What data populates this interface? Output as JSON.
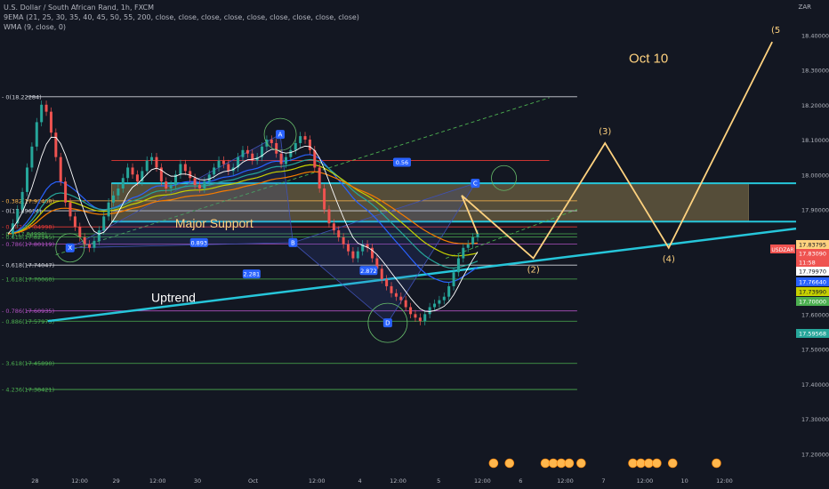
{
  "header": {
    "title": "U.S. Dollar / South African Rand, 1h, FXCM",
    "ema_line": "9EMA (21, 25, 30, 35, 40, 45, 50, 55, 200, close, close, close, close, close, close, close, close, close)",
    "wma_line": "WMA (9, close, 0)"
  },
  "currency": "ZAR",
  "colors": {
    "background": "#131722",
    "up": "#26a69a",
    "down": "#ef5350",
    "uptrend": "#26c6da",
    "projection": "#ffd27f",
    "fib_green": "#4caf50",
    "fib_purple": "#b050c0",
    "fib_red": "#e53935",
    "zone": "#8d7a4d",
    "harmonic": "#3f51b5",
    "ema_orange": "#f57c00",
    "ema_yellow": "#c6d000",
    "ema_blue": "#2962ff"
  },
  "annotations": {
    "date_label": "Oct 10",
    "support_label": "Major Support",
    "uptrend_label": "Uptrend"
  },
  "chart_data": {
    "type": "candlestick",
    "symbol": "USDZAR",
    "price_axis_ticks": [
      18.4,
      18.3,
      18.2,
      18.1,
      18.0,
      17.9,
      17.8,
      17.7,
      17.6,
      17.5,
      17.4,
      17.3,
      17.2
    ],
    "price_tick_labels": [
      "18.40000",
      "18.30000",
      "18.20000",
      "18.10000",
      "18.00000",
      "17.90000",
      "17.80000",
      "17.70000",
      "17.60000",
      "17.50000",
      "17.40000",
      "17.30000",
      "17.20000"
    ],
    "time_tick_labels": [
      "28",
      "12:00",
      "29",
      "12:00",
      "30",
      "Oct",
      "12:00",
      "4",
      "12:00",
      "5",
      "12:00",
      "6",
      "12:00",
      "7",
      "12:00",
      "10",
      "12:00"
    ],
    "price_badges": [
      {
        "text": "USDZAR",
        "color": "#ef5350"
      },
      {
        "text": "17.83795",
        "color": "#ffd27f"
      },
      {
        "text": "17.83090",
        "color": "#ef5350"
      },
      {
        "text": "11:58",
        "color": "#ef5350"
      },
      {
        "text": "17.79970",
        "color": "#ffffff"
      },
      {
        "text": "17.76640",
        "color": "#2962ff"
      },
      {
        "text": "17.73990",
        "color": "#c6d000"
      },
      {
        "text": "17.70000",
        "color": "#4caf50"
      },
      {
        "text": "17.59568",
        "color": "#26a69a"
      }
    ],
    "fib_levels": [
      {
        "label": "0(18.22284)",
        "value": 18.22284,
        "color": "#d1d4dc"
      },
      {
        "label": "0(17.89614)",
        "value": 17.89614,
        "color": "#d1d4dc"
      },
      {
        "label": "0.382(17.92468)",
        "value": 17.92468,
        "color": "#ffb74d"
      },
      {
        "label": "0.382(17.84998)",
        "value": 17.84998,
        "color": "#e53935"
      },
      {
        "label": "0.5(17.84998)",
        "value": 17.83,
        "color": "#4caf50"
      },
      {
        "label": "0.618(17.82145)",
        "value": 17.82145,
        "color": "#4caf50"
      },
      {
        "label": "0.786(17.80119)",
        "value": 17.80119,
        "color": "#b050c0"
      },
      {
        "label": "0.618(17.74047)",
        "value": 17.74047,
        "color": "#d1d4dc"
      },
      {
        "label": "1.618(17.70060)",
        "value": 17.7006,
        "color": "#4caf50"
      },
      {
        "label": "0.786(17.60935)",
        "value": 17.60935,
        "color": "#b050c0"
      },
      {
        "label": "0.886(17.57975)",
        "value": 17.57975,
        "color": "#4caf50"
      },
      {
        "label": "3.618(17.45890)",
        "value": 17.4589,
        "color": "#4caf50"
      },
      {
        "label": "4.236(17.38421)",
        "value": 17.38421,
        "color": "#4caf50"
      }
    ],
    "harmonic_points": [
      {
        "label": "X",
        "price": 17.79,
        "time": 0.088
      },
      {
        "label": "A",
        "price": 18.115,
        "time": 0.352
      },
      {
        "label": "B",
        "price": 17.805,
        "time": 0.368
      },
      {
        "label": "C",
        "price": 17.975,
        "time": 0.597
      },
      {
        "label": "D",
        "price": 17.575,
        "time": 0.487
      }
    ],
    "harmonic_ratios": [
      "0.56",
      "0.893",
      "2.281",
      "2.872"
    ],
    "projection_wave": [
      {
        "label": "",
        "time": 0.58,
        "price": 17.94
      },
      {
        "label": "(2)",
        "time": 0.67,
        "price": 17.76
      },
      {
        "label": "(3)",
        "time": 0.76,
        "price": 18.09
      },
      {
        "label": "(4)",
        "time": 0.84,
        "price": 17.79
      },
      {
        "label": "(5",
        "time": 0.97,
        "price": 18.38
      }
    ],
    "candles_ohlc_hint": "hourly candles from 28 Sep to 5 Oct, range approx 17.56 - 18.23",
    "candles": [
      17.83,
      17.86,
      17.9,
      17.95,
      18.02,
      18.08,
      18.15,
      18.2,
      18.18,
      18.12,
      18.05,
      17.98,
      17.92,
      17.88,
      17.85,
      17.82,
      17.8,
      17.79,
      17.81,
      17.84,
      17.88,
      17.92,
      17.94,
      17.96,
      17.99,
      18.02,
      18.0,
      17.98,
      18.01,
      18.04,
      18.05,
      18.02,
      17.98,
      17.96,
      17.97,
      18.0,
      18.03,
      18.01,
      17.99,
      17.97,
      17.96,
      17.98,
      18.0,
      18.02,
      18.04,
      18.03,
      18.01,
      18.02,
      18.05,
      18.07,
      18.06,
      18.04,
      18.05,
      18.08,
      18.1,
      18.09,
      18.06,
      18.03,
      18.05,
      18.07,
      18.09,
      18.11,
      18.1,
      18.07,
      18.02,
      17.96,
      17.9,
      17.86,
      17.84,
      17.82,
      17.8,
      17.78,
      17.76,
      17.78,
      17.8,
      17.79,
      17.76,
      17.73,
      17.7,
      17.68,
      17.66,
      17.65,
      17.64,
      17.62,
      17.6,
      17.59,
      17.58,
      17.6,
      17.62,
      17.63,
      17.64,
      17.65,
      17.68,
      17.72,
      17.76,
      17.79,
      17.8,
      17.82,
      17.83
    ],
    "wave_labels": [
      "(2)",
      "(3)",
      "(2)",
      "(4)",
      "(5"
    ],
    "xlim": [
      0,
      1
    ],
    "ylim": [
      17.15,
      18.5
    ]
  }
}
